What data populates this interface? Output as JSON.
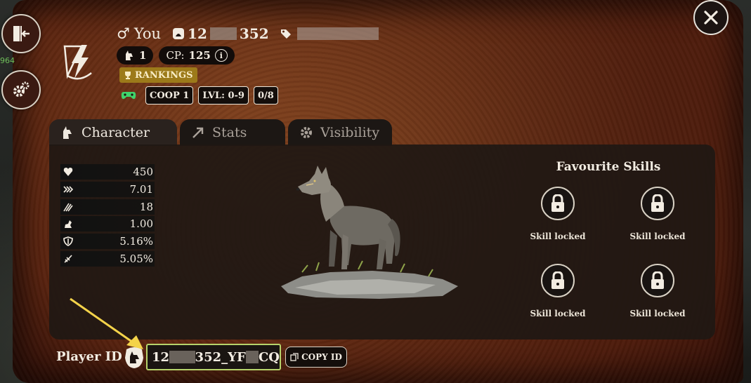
{
  "header": {
    "gender_symbol": "♂",
    "player_name": "You",
    "id_prefix": "12",
    "id_suffix": "352",
    "level_count": "1",
    "cp_label": "CP:",
    "cp_value": "125",
    "info_symbol": "i",
    "rankings_label": "RANKINGS"
  },
  "coop": {
    "mode": "COOP 1",
    "level_range": "LVL: 0-9",
    "slots": "0/8"
  },
  "tabs": [
    {
      "label": "Character",
      "icon": "wolf-head-icon",
      "active": true
    },
    {
      "label": "Stats",
      "icon": "arrow-up-right-icon",
      "active": false
    },
    {
      "label": "Visibility",
      "icon": "gear-icon",
      "active": false
    }
  ],
  "stats": [
    {
      "icon": "heart-icon",
      "value": "450"
    },
    {
      "icon": "speed-icon",
      "value": "7.01"
    },
    {
      "icon": "claw-icon",
      "value": "18"
    },
    {
      "icon": "stamina-icon",
      "value": "1.00"
    },
    {
      "icon": "shield-icon",
      "value": "5.16%"
    },
    {
      "icon": "critical-icon",
      "value": "5.05%"
    }
  ],
  "favourite_skills": {
    "title": "Favourite Skills",
    "skills": [
      {
        "label": "Skill locked"
      },
      {
        "label": "Skill locked"
      },
      {
        "label": "Skill locked"
      },
      {
        "label": "Skill locked"
      }
    ]
  },
  "footer": {
    "player_id_label": "Player ID",
    "player_id_part1": "12",
    "player_id_part2": "352_YF",
    "player_id_part3": "CQ",
    "copy_label": "COPY ID"
  },
  "side_counter": "964",
  "colors": {
    "accent_gold": "#9c7a1a",
    "highlight_green": "#b6d36b",
    "gamepad_green": "#3fd36a",
    "annotation_arrow": "#f4d34a"
  }
}
